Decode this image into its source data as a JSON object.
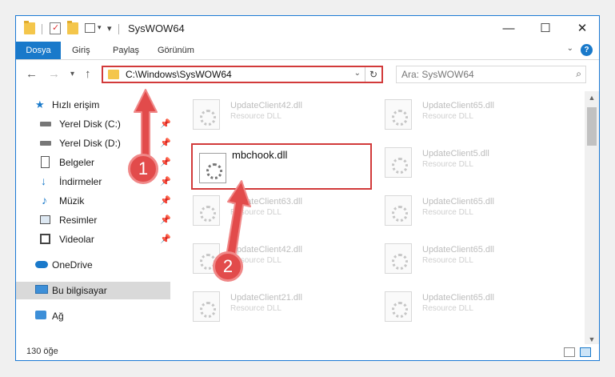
{
  "window": {
    "title": "SysWOW64"
  },
  "ribbon": {
    "tabs": [
      "Dosya",
      "Giriş",
      "Paylaş",
      "Görünüm"
    ]
  },
  "help": {
    "label": "?"
  },
  "address": {
    "path": "C:\\Windows\\SysWOW64"
  },
  "search": {
    "placeholder": "Ara: SysWOW64"
  },
  "sidebar": {
    "quick_access": "Hızlı erişim",
    "items": [
      {
        "label": "Yerel Disk (C:)",
        "icon": "drive-icon"
      },
      {
        "label": "Yerel Disk (D:)",
        "icon": "drive-icon"
      },
      {
        "label": "Belgeler",
        "icon": "documents-icon"
      },
      {
        "label": "İndirmeler",
        "icon": "downloads-icon"
      },
      {
        "label": "Müzik",
        "icon": "music-icon"
      },
      {
        "label": "Resimler",
        "icon": "pictures-icon"
      },
      {
        "label": "Videolar",
        "icon": "videos-icon"
      }
    ],
    "onedrive": "OneDrive",
    "this_pc": "Bu bilgisayar",
    "network": "Ağ"
  },
  "files": {
    "highlighted": {
      "name": "mbchook.dll"
    },
    "left_column": [
      {
        "name": "UpdateClient42.dll",
        "desc": "Resource DLL"
      },
      {
        "name": "UpdateClient63.dll",
        "desc": "Resource DLL"
      },
      {
        "name": "UpdateClient42.dll",
        "desc": "Resource DLL"
      },
      {
        "name": "UpdateClient21.dll",
        "desc": "Resource DLL"
      }
    ],
    "right_column": [
      {
        "name": "UpdateClient65.dll",
        "desc": "Resource DLL"
      },
      {
        "name": "UpdateClient5.dll",
        "desc": "Resource DLL"
      },
      {
        "name": "UpdateClient65.dll",
        "desc": "Resource DLL"
      },
      {
        "name": "UpdateClient65.dll",
        "desc": "Resource DLL"
      },
      {
        "name": "UpdateClient65.dll",
        "desc": "Resource DLL"
      }
    ]
  },
  "status": {
    "count": "130 öğe"
  },
  "annotations": {
    "step1": "1",
    "step2": "2"
  },
  "colors": {
    "accent": "#1979ca",
    "highlight": "#d23a3a",
    "annotation": "#e24b4b",
    "folder": "#f4c64b"
  }
}
